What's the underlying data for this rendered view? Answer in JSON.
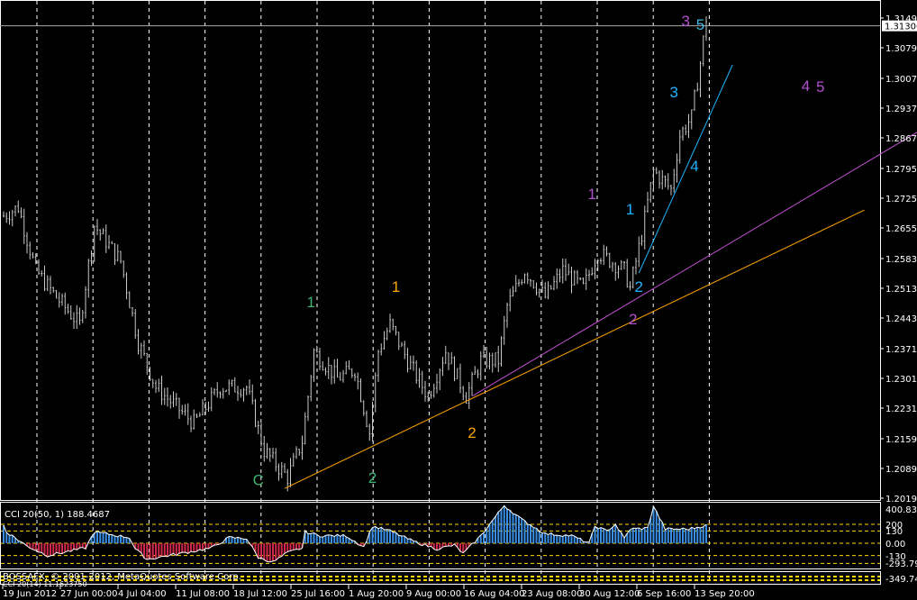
{
  "chart_data": {
    "type": "ohlc",
    "symbol_hint": "",
    "price_axis": {
      "ticks": [
        "1.31490",
        "1.30790",
        "1.30070",
        "1.29370",
        "1.28670",
        "1.27950",
        "1.27250",
        "1.26550",
        "1.25830",
        "1.25130",
        "1.24430",
        "1.23710",
        "1.23010",
        "1.22310",
        "1.21590",
        "1.20890",
        "1.20190"
      ],
      "ylim": [
        1.2019,
        1.3149
      ],
      "current_price": "1.31306"
    },
    "time_axis": {
      "labels": [
        "19 Jun 2012",
        "27 Jun 00:00",
        "4 Jul 04:00",
        "11 Jul 08:00",
        "18 Jul 12:00",
        "25 Jul 16:00",
        "1 Aug 20:00",
        "9 Aug 00:00",
        "16 Aug 04:00",
        "23 Aug 08:00",
        "30 Aug 12:00",
        "6 Sep 16:00",
        "13 Sep 20:00"
      ]
    },
    "price_keypoints_bar_price": [
      [
        0,
        1.2683
      ],
      [
        5,
        1.2704
      ],
      [
        11,
        1.2555
      ],
      [
        18,
        1.2492
      ],
      [
        26,
        1.2428
      ],
      [
        31,
        1.2661
      ],
      [
        40,
        1.2577
      ],
      [
        46,
        1.2386
      ],
      [
        52,
        1.228
      ],
      [
        65,
        1.2195
      ],
      [
        74,
        1.228
      ],
      [
        83,
        1.228
      ],
      [
        89,
        1.2131
      ],
      [
        97,
        1.2068
      ],
      [
        102,
        1.2153
      ],
      [
        106,
        1.2365
      ],
      [
        114,
        1.2301
      ],
      [
        120,
        1.2322
      ],
      [
        125,
        1.2174
      ],
      [
        128,
        1.2365
      ],
      [
        132,
        1.2428
      ],
      [
        138,
        1.2343
      ],
      [
        145,
        1.2259
      ],
      [
        151,
        1.2365
      ],
      [
        158,
        1.2259
      ],
      [
        163,
        1.2343
      ],
      [
        169,
        1.2343
      ],
      [
        172,
        1.2471
      ],
      [
        178,
        1.2555
      ],
      [
        185,
        1.2492
      ],
      [
        191,
        1.2555
      ],
      [
        198,
        1.2513
      ],
      [
        203,
        1.2598
      ],
      [
        212,
        1.2555
      ],
      [
        214,
        1.2513
      ],
      [
        218,
        1.264
      ],
      [
        222,
        1.2789
      ],
      [
        228,
        1.2746
      ],
      [
        231,
        1.2873
      ],
      [
        235,
        1.2916
      ],
      [
        238,
        1.3043
      ],
      [
        240,
        1.3149
      ]
    ],
    "trendlines": [
      {
        "name": "orange",
        "color": "#ffa500",
        "from": [
          96,
          1.2042
        ],
        "to": [
          294,
          1.2697
        ]
      },
      {
        "name": "violet",
        "color": "#c050d0",
        "from": [
          160,
          1.2259
        ],
        "to": [
          313,
          1.2884
        ]
      },
      {
        "name": "cyan",
        "color": "#1eb4ff",
        "from": [
          217,
          1.2549
        ],
        "to": [
          249,
          1.3039
        ]
      }
    ],
    "wave_labels": [
      {
        "text": "3",
        "color": "#b050d0",
        "bar": 233,
        "price": 1.3143
      },
      {
        "text": "5",
        "color": "#40b8e0",
        "bar": 238,
        "price": 1.3134
      },
      {
        "text": "4",
        "color": "#b050d0",
        "bar": 274,
        "price": 1.299
      },
      {
        "text": "5",
        "color": "#b050d0",
        "bar": 279,
        "price": 1.2988
      },
      {
        "text": "3",
        "color": "#1eb4ff",
        "bar": 229,
        "price": 1.2975
      },
      {
        "text": "4",
        "color": "#1eb4ff",
        "bar": 236,
        "price": 1.2801
      },
      {
        "text": "1",
        "color": "#1eb4ff",
        "bar": 214,
        "price": 1.27
      },
      {
        "text": "2",
        "color": "#1eb4ff",
        "bar": 217,
        "price": 1.2517
      },
      {
        "text": "1",
        "color": "#b050d0",
        "bar": 201,
        "price": 1.2736
      },
      {
        "text": "2",
        "color": "#b050d0",
        "bar": 215,
        "price": 1.2441
      },
      {
        "text": "1",
        "color": "#ffa500",
        "bar": 134,
        "price": 1.2517
      },
      {
        "text": "2",
        "color": "#ffa500",
        "bar": 160,
        "price": 1.2174
      },
      {
        "text": "1",
        "color": "#3cb371",
        "bar": 105,
        "price": 1.2481
      },
      {
        "text": "2",
        "color": "#3cb371",
        "bar": 126,
        "price": 1.2068
      },
      {
        "text": "C",
        "color": "#3cb371",
        "bar": 87,
        "price": 1.2062
      }
    ]
  },
  "cci": {
    "title": "CCI 20(50, 1) 188.4687",
    "levels": [
      "400.8320",
      "200",
      "130",
      "0.00",
      "-130",
      "-293.798"
    ],
    "level_values": [
      200,
      130,
      0,
      -130
    ],
    "keypoints_bar_value": [
      [
        1,
        120
      ],
      [
        8,
        -30
      ],
      [
        15,
        -130
      ],
      [
        28,
        -50
      ],
      [
        31,
        120
      ],
      [
        43,
        60
      ],
      [
        45,
        -60
      ],
      [
        49,
        -170
      ],
      [
        62,
        -100
      ],
      [
        71,
        -50
      ],
      [
        77,
        60
      ],
      [
        83,
        50
      ],
      [
        87,
        -150
      ],
      [
        92,
        -200
      ],
      [
        97,
        -100
      ],
      [
        102,
        -50
      ],
      [
        103,
        120
      ],
      [
        108,
        80
      ],
      [
        117,
        80
      ],
      [
        123,
        -40
      ],
      [
        126,
        180
      ],
      [
        132,
        130
      ],
      [
        140,
        20
      ],
      [
        148,
        -60
      ],
      [
        154,
        -20
      ],
      [
        157,
        -110
      ],
      [
        163,
        80
      ],
      [
        171,
        400
      ],
      [
        177,
        250
      ],
      [
        185,
        100
      ],
      [
        194,
        80
      ],
      [
        200,
        0
      ],
      [
        202,
        180
      ],
      [
        206,
        130
      ],
      [
        209,
        200
      ],
      [
        212,
        50
      ],
      [
        214,
        150
      ],
      [
        220,
        160
      ],
      [
        222,
        390
      ],
      [
        226,
        150
      ],
      [
        234,
        150
      ],
      [
        240,
        190
      ]
    ]
  },
  "cci2": {
    "title": "CCI 20(14) 11.1623750",
    "level": "-349.741"
  },
  "copyright": "BOSSAFX, © 2001-2012, MetaQuotes Software Corp.",
  "colors": {
    "bars": "#c8c8c8",
    "grid": "#ffffff",
    "level": "#ffd700",
    "cci_pos": "#3a8ee6",
    "cci_neg": "#d0284a"
  }
}
